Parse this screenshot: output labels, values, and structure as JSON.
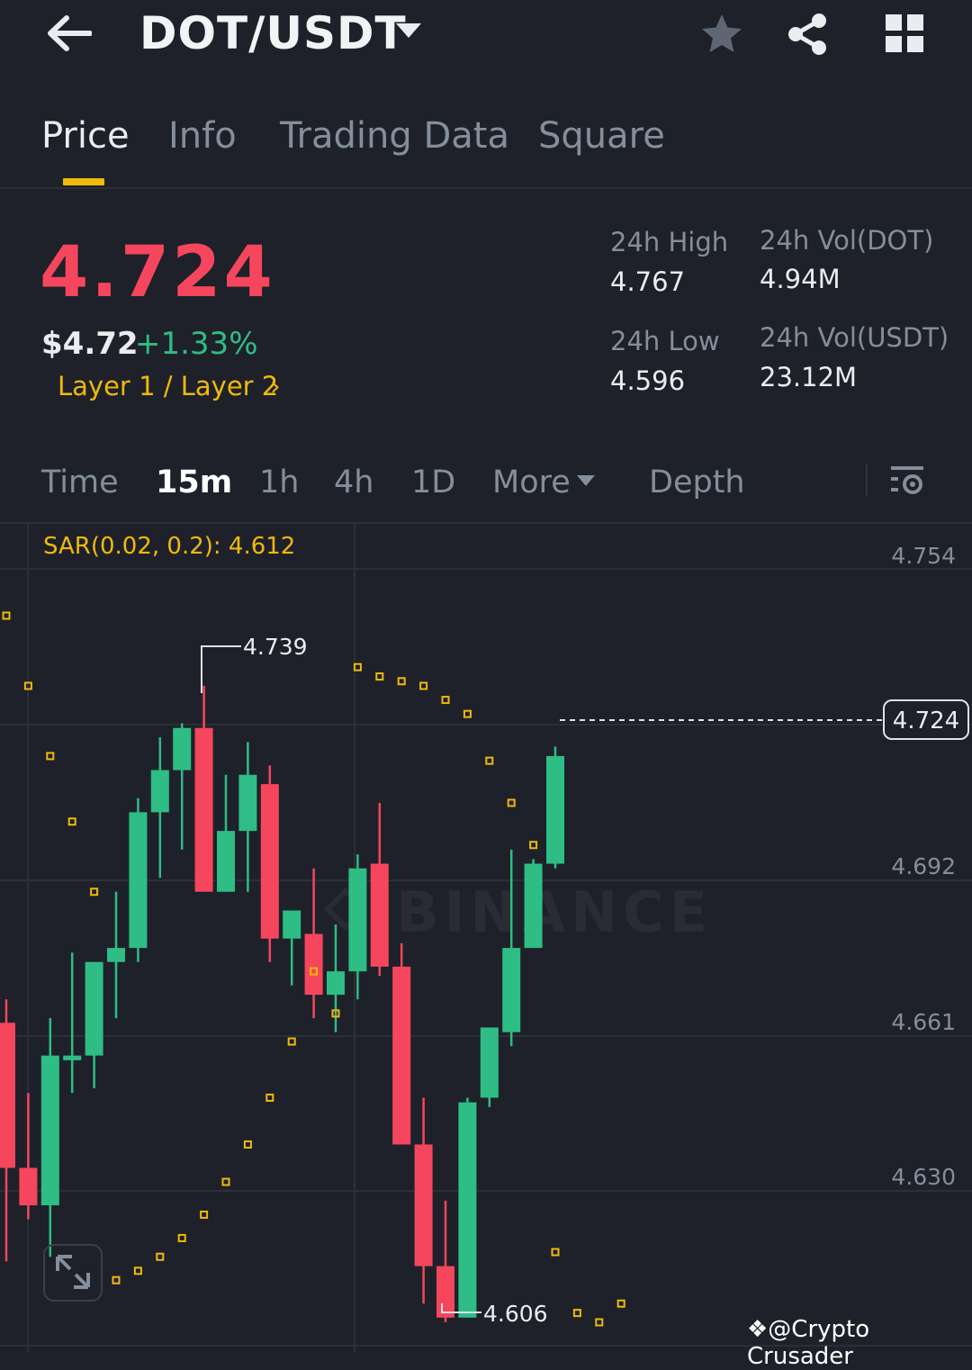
{
  "header": {
    "pair": "DOT/USDT",
    "icons": [
      "back-arrow-icon",
      "caret-down-icon",
      "star-icon",
      "share-icon",
      "grid-icon"
    ]
  },
  "tabs": [
    {
      "label": "Price",
      "active": true
    },
    {
      "label": "Info",
      "active": false
    },
    {
      "label": "Trading Data",
      "active": false
    },
    {
      "label": "Square",
      "active": false
    }
  ],
  "ticker": {
    "last_price": "4.724",
    "usd_price": "$4.72",
    "change": "+1.33%",
    "category": "Layer 1 / Layer 2",
    "high_label": "24h High",
    "high": "4.767",
    "low_label": "24h Low",
    "low": "4.596",
    "vol_base_label": "24h Vol(DOT)",
    "vol_base": "4.94M",
    "vol_quote_label": "24h Vol(USDT)",
    "vol_quote": "23.12M"
  },
  "intervals": [
    {
      "label": "Time",
      "active": false
    },
    {
      "label": "15m",
      "active": true
    },
    {
      "label": "1h",
      "active": false
    },
    {
      "label": "4h",
      "active": false
    },
    {
      "label": "1D",
      "active": false
    },
    {
      "label": "More",
      "active": false
    },
    {
      "label": "Depth",
      "active": false
    }
  ],
  "chart": {
    "indicator_label": "SAR(0.02, 0.2): 4.612",
    "price_axis": [
      "4.754",
      "4.692",
      "4.661",
      "4.630"
    ],
    "current_price": "4.724",
    "high_marker": "4.739",
    "low_marker": "4.606",
    "watermark": "BINANCE",
    "colors": {
      "up": "#2ebd85",
      "down": "#f6465d",
      "sar": "#f0b90b"
    }
  },
  "chart_data": {
    "type": "candlestick",
    "ylim": [
      4.598,
      4.764
    ],
    "candles": [
      {
        "o": 4.667,
        "h": 4.672,
        "l": 4.616,
        "c": 4.636
      },
      {
        "o": 4.636,
        "h": 4.652,
        "l": 4.625,
        "c": 4.628
      },
      {
        "o": 4.628,
        "h": 4.668,
        "l": 4.617,
        "c": 4.66
      },
      {
        "o": 4.659,
        "h": 4.682,
        "l": 4.652,
        "c": 4.66
      },
      {
        "o": 4.66,
        "h": 4.68,
        "l": 4.653,
        "c": 4.68
      },
      {
        "o": 4.68,
        "h": 4.695,
        "l": 4.668,
        "c": 4.683
      },
      {
        "o": 4.683,
        "h": 4.715,
        "l": 4.68,
        "c": 4.712
      },
      {
        "o": 4.712,
        "h": 4.728,
        "l": 4.698,
        "c": 4.721
      },
      {
        "o": 4.721,
        "h": 4.731,
        "l": 4.704,
        "c": 4.73
      },
      {
        "o": 4.73,
        "h": 4.739,
        "l": 4.699,
        "c": 4.695
      },
      {
        "o": 4.695,
        "h": 4.72,
        "l": 4.695,
        "c": 4.708
      },
      {
        "o": 4.708,
        "h": 4.727,
        "l": 4.695,
        "c": 4.72
      },
      {
        "o": 4.718,
        "h": 4.722,
        "l": 4.68,
        "c": 4.685
      },
      {
        "o": 4.685,
        "h": 4.691,
        "l": 4.675,
        "c": 4.691
      },
      {
        "o": 4.686,
        "h": 4.7,
        "l": 4.668,
        "c": 4.673
      },
      {
        "o": 4.673,
        "h": 4.688,
        "l": 4.665,
        "c": 4.678
      },
      {
        "o": 4.678,
        "h": 4.703,
        "l": 4.672,
        "c": 4.7
      },
      {
        "o": 4.701,
        "h": 4.714,
        "l": 4.677,
        "c": 4.679
      },
      {
        "o": 4.679,
        "h": 4.684,
        "l": 4.641,
        "c": 4.641
      },
      {
        "o": 4.641,
        "h": 4.651,
        "l": 4.607,
        "c": 4.615
      },
      {
        "o": 4.615,
        "h": 4.629,
        "l": 4.603,
        "c": 4.604
      },
      {
        "o": 4.604,
        "h": 4.651,
        "l": 4.604,
        "c": 4.65
      },
      {
        "o": 4.651,
        "h": 4.665,
        "l": 4.649,
        "c": 4.666
      },
      {
        "o": 4.665,
        "h": 4.704,
        "l": 4.662,
        "c": 4.683
      },
      {
        "o": 4.683,
        "h": 4.702,
        "l": 4.683,
        "c": 4.701
      },
      {
        "o": 4.701,
        "h": 4.726,
        "l": 4.7,
        "c": 4.724
      }
    ],
    "sar": [
      4.754,
      4.739,
      4.724,
      4.71,
      4.695,
      4.612,
      4.614,
      4.617,
      4.621,
      4.626,
      4.633,
      4.641,
      4.651,
      4.663,
      4.678,
      4.669,
      4.743,
      4.741,
      4.74,
      4.739,
      4.736,
      4.733,
      4.723,
      4.714,
      4.705,
      4.618,
      4.605,
      4.603,
      4.607
    ]
  }
}
